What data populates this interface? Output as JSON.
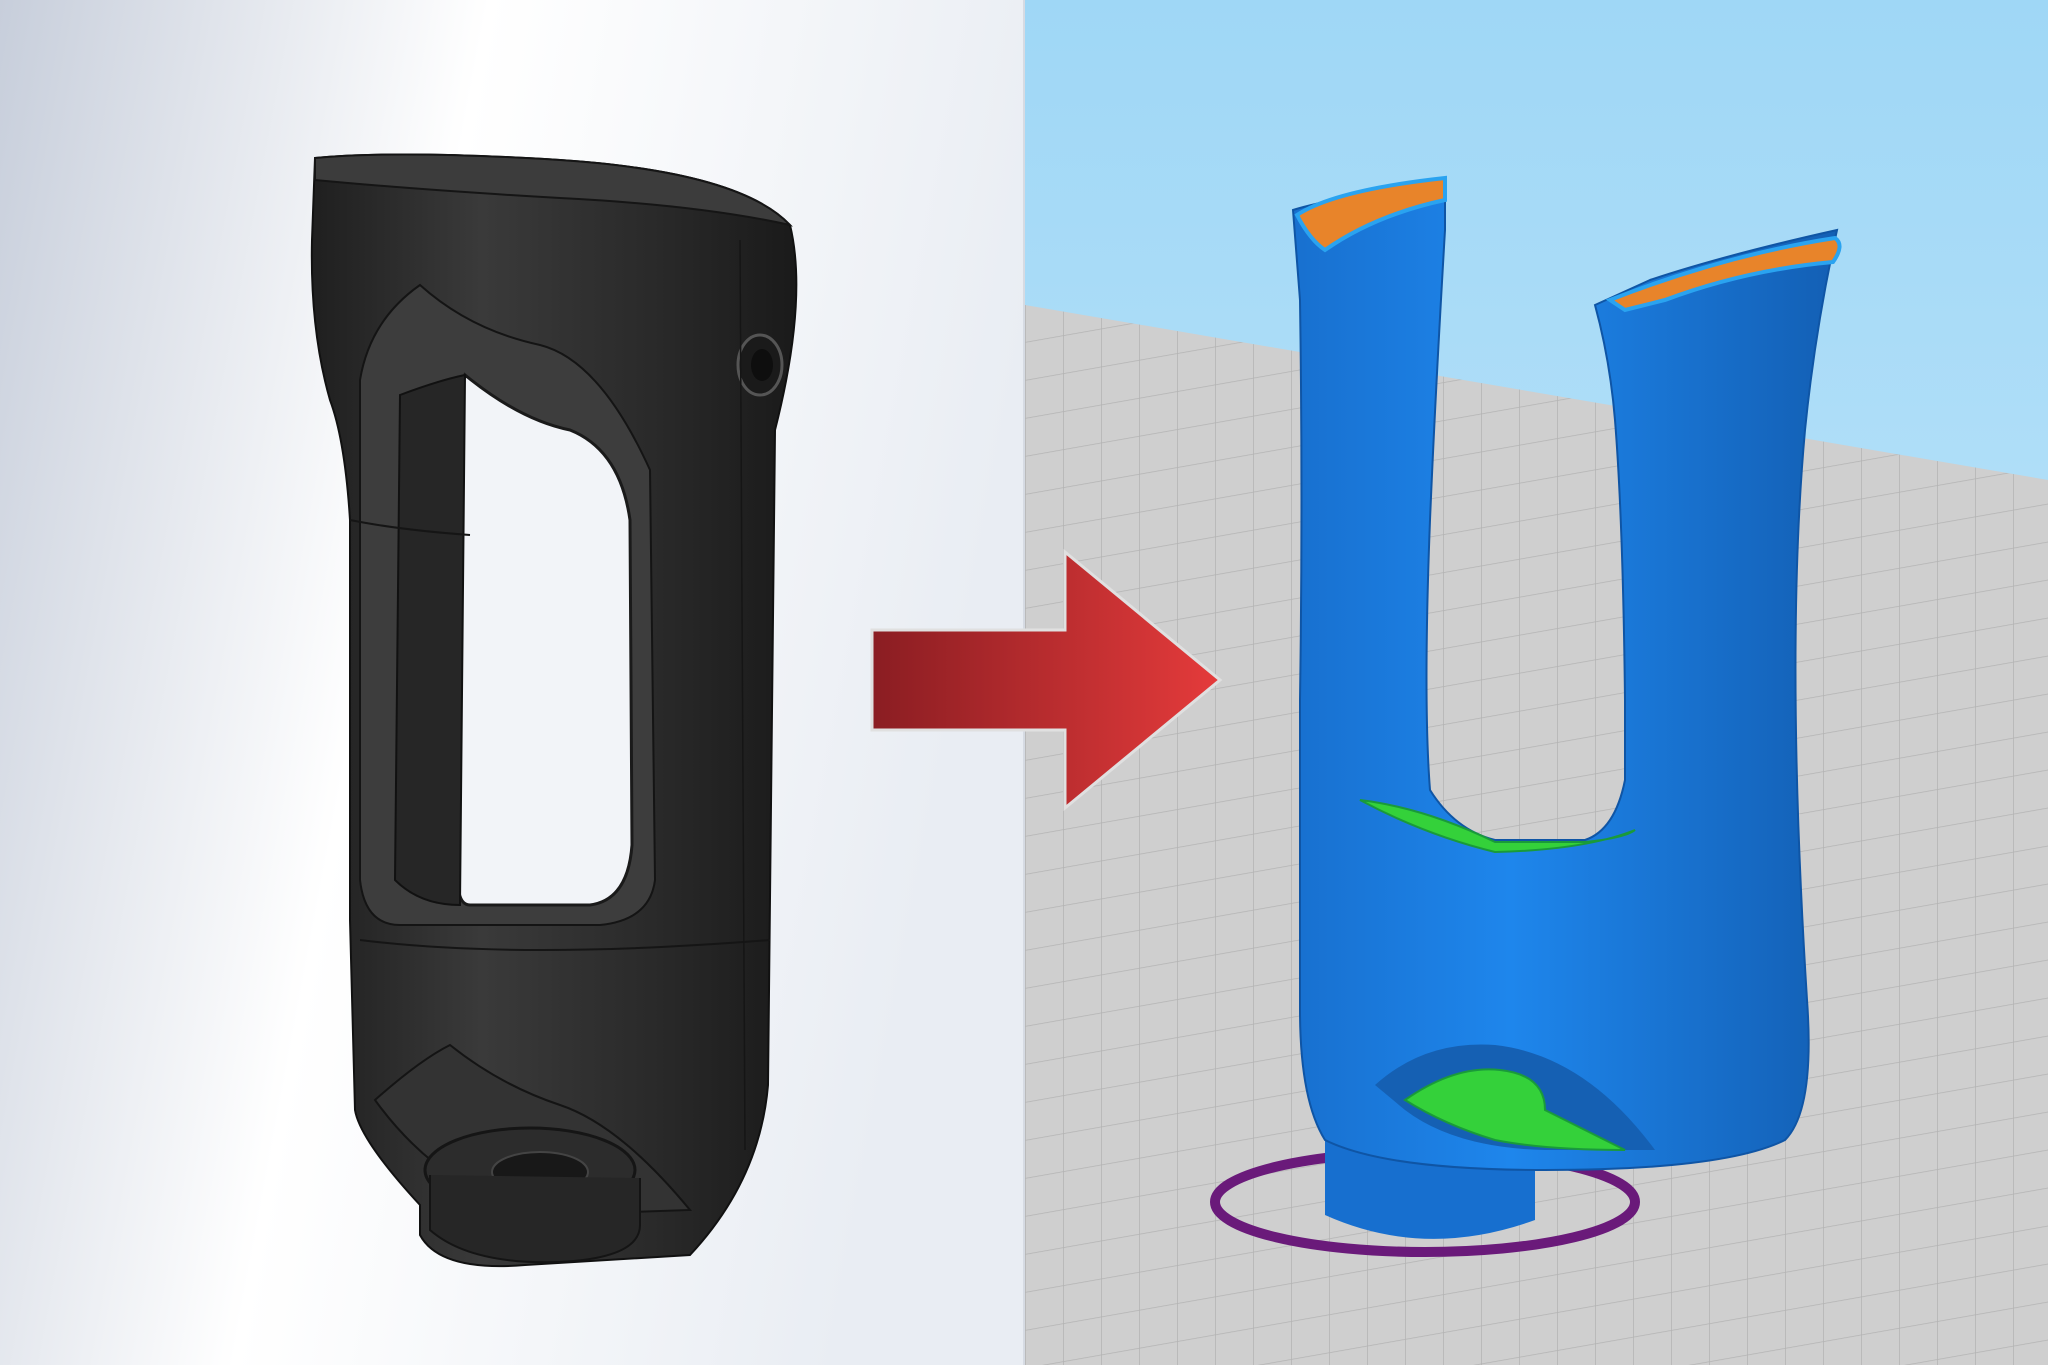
{
  "colors": {
    "cad_background_top": "#ffffff",
    "cad_background_side": "#c9d0dd",
    "cad_part": "#2b2b2b",
    "cad_part_highlight": "#4a4a4a",
    "slicer_sky": "#a9dcf7",
    "slicer_bed": "#cfcfcf",
    "slicer_grid": "#b5b5b5",
    "print_body": "#1a7de0",
    "print_body_dark": "#1466be",
    "infill_orange": "#e8842a",
    "support_green": "#34d13a",
    "brim_purple": "#6a1a7a",
    "arrow_dark": "#8a1d22",
    "arrow_light": "#e53b3b"
  },
  "icons": {
    "arrow": "right-arrow-icon"
  }
}
